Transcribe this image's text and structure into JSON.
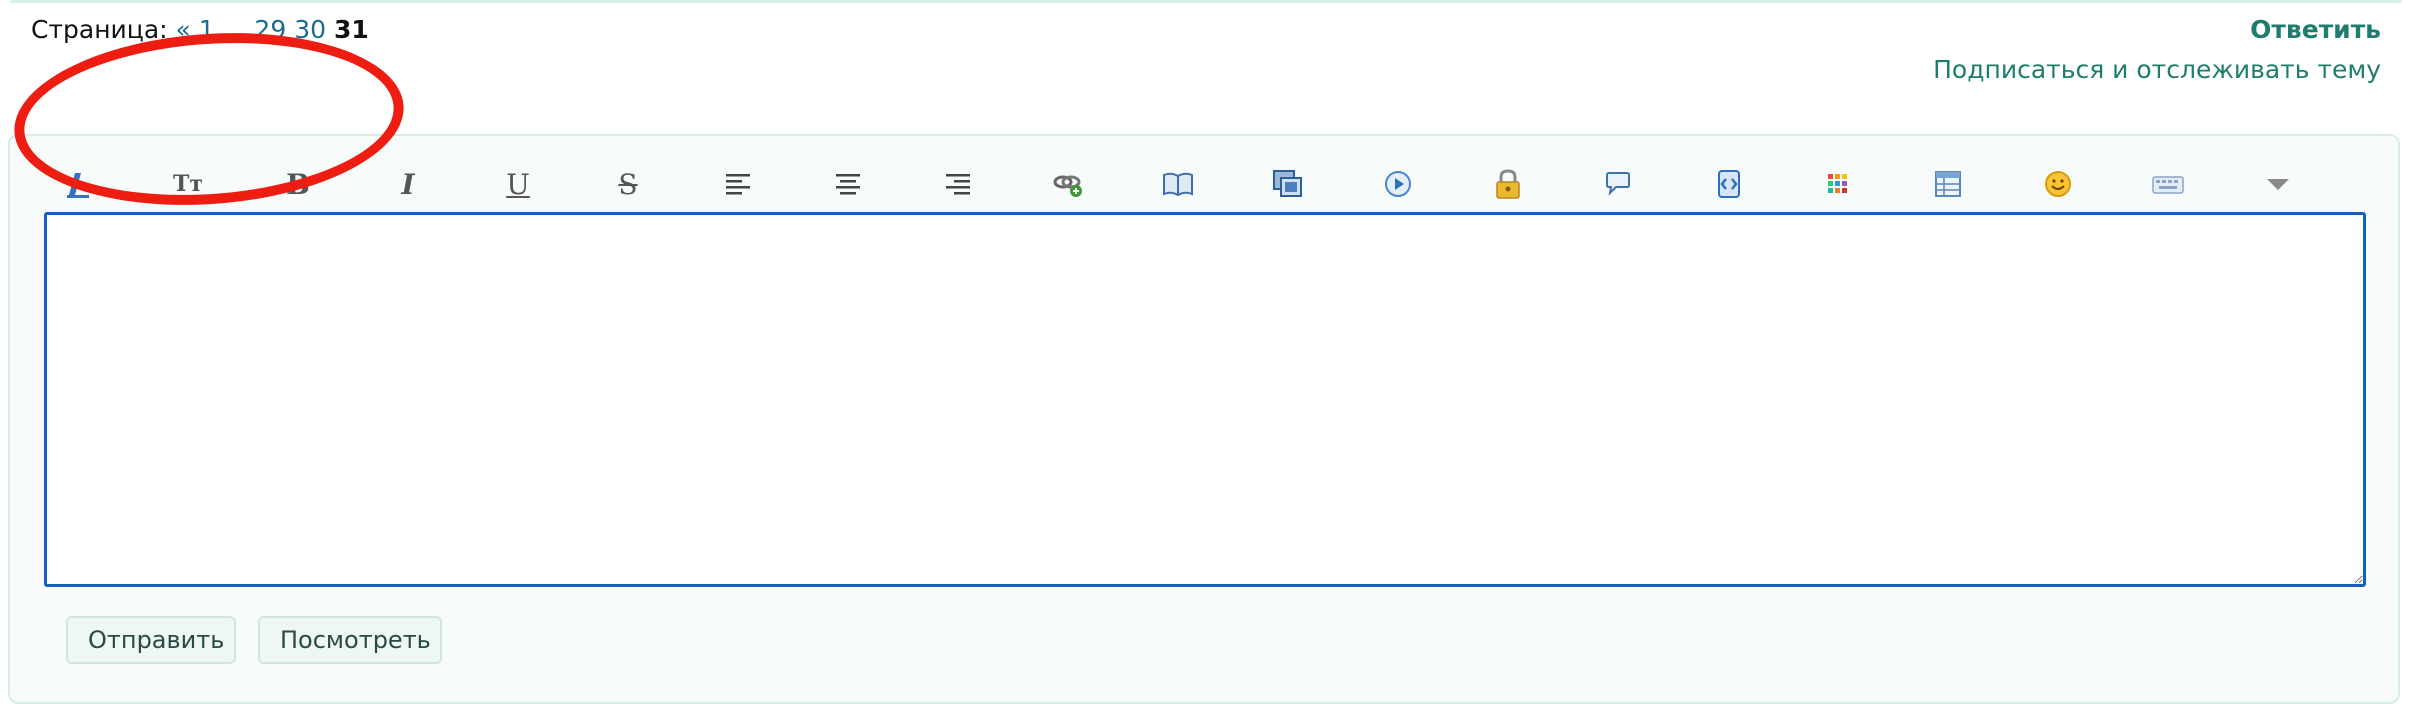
{
  "pagination": {
    "label": "Страница:",
    "prev": "«",
    "first": "1",
    "ellipsis": "...",
    "pages": [
      "29",
      "30"
    ],
    "current": "31"
  },
  "actions": {
    "reply": "Ответить",
    "subscribe": "Подписаться и отслеживать тему"
  },
  "toolbar": {
    "font_size_label": "Tт",
    "bold_label": "B",
    "italic_label": "I",
    "underline_label": "U",
    "strike_label": "S",
    "buttons": [
      "font-color",
      "font-size",
      "bold",
      "italic",
      "underline",
      "strikethrough",
      "align-left",
      "align-center",
      "align-right",
      "link",
      "book",
      "image",
      "media",
      "lock",
      "quote",
      "code",
      "colors",
      "table",
      "smiley",
      "keyboard",
      "more"
    ]
  },
  "editor": {
    "value": ""
  },
  "buttons": {
    "send": "Отправить",
    "preview": "Посмотреть"
  },
  "colors": {
    "accent": "#1e7d6e",
    "link": "#1c6a8f",
    "editor_border": "#1560b8",
    "annotation": "#ee1d12"
  }
}
